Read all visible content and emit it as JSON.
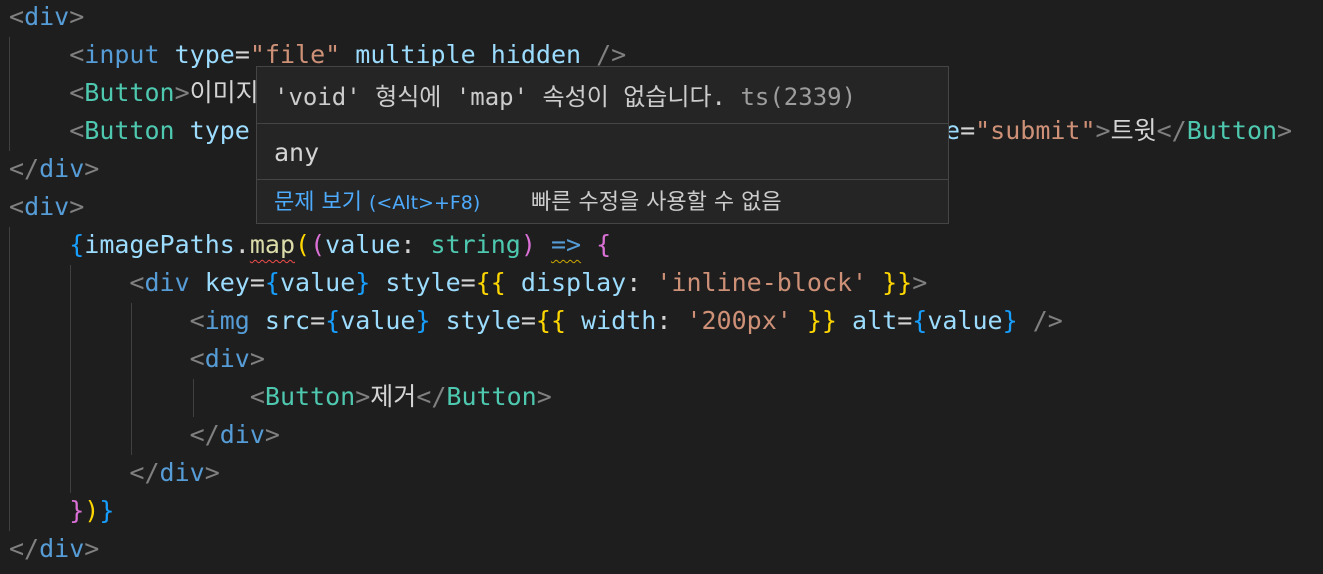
{
  "colors": {
    "background": "#1e1e1e",
    "tag": "#569cd6",
    "component": "#4ec9b0",
    "attribute": "#9cdcfe",
    "string": "#ce9178",
    "error_squiggle": "#f14c4c",
    "link": "#4daafc"
  },
  "code": {
    "l1_open": "<",
    "l1_tag": "div",
    "l1_close": ">",
    "l2_indent": "    ",
    "l2_lt": "<",
    "l2_tag": "input",
    "l2_sp1": " ",
    "l2_attr": "type",
    "l2_eq": "=",
    "l2_val": "\"file\"",
    "l2_sp2": " ",
    "l2_attr2": "multiple",
    "l2_sp3": " ",
    "l2_attr3": "hidden",
    "l2_sp4": " ",
    "l2_end": "/>",
    "l3_indent": "    ",
    "l3_lt": "<",
    "l3_tag": "Button",
    "l3_gt": ">",
    "l3_text": "이미지",
    "l4_indent": "    ",
    "l4_lt": "<",
    "l4_tag": "Button",
    "l4_sp": " ",
    "l4_attr": "type",
    "l4_tail_attr": "e",
    "l4_tail_eq": "=",
    "l4_tail_val": "\"submit\"",
    "l4_tail_gt": ">",
    "l4_tail_text": "트윗",
    "l4_tail_close1": "</",
    "l4_tail_tag": "Button",
    "l4_tail_close2": ">",
    "l5_open": "</",
    "l5_tag": "div",
    "l5_close": ">",
    "l6_open": "<",
    "l6_tag": "div",
    "l6_close": ">",
    "l7_indent": "    ",
    "l7_brace": "{",
    "l7_var": "imagePaths",
    "l7_dot": ".",
    "l7_fn": "map",
    "l7_paren1": "(",
    "l7_paren2": "(",
    "l7_param": "value",
    "l7_colon": ": ",
    "l7_type": "string",
    "l7_paren3": ")",
    "l7_sp": " ",
    "l7_arrow": "=>",
    "l7_sp2": " ",
    "l7_brace2": "{",
    "l8_indent": "        ",
    "l8_lt": "<",
    "l8_tag": "div",
    "l8_sp": " ",
    "l8_attr": "key",
    "l8_eq": "=",
    "l8_b1": "{",
    "l8_val": "value",
    "l8_b2": "}",
    "l8_sp2": " ",
    "l8_attr2": "style",
    "l8_eq2": "=",
    "l8_b3": "{{",
    "l8_sp3": " ",
    "l8_prop": "display",
    "l8_colon": ": ",
    "l8_str": "'inline-block'",
    "l8_sp4": " ",
    "l8_b4": "}}",
    "l8_gt": ">",
    "l9_indent": "            ",
    "l9_lt": "<",
    "l9_tag": "img",
    "l9_sp": " ",
    "l9_attr": "src",
    "l9_eq": "=",
    "l9_b1": "{",
    "l9_val": "value",
    "l9_b2": "}",
    "l9_sp2": " ",
    "l9_attr2": "style",
    "l9_eq2": "=",
    "l9_b3": "{{",
    "l9_sp3": " ",
    "l9_prop": "width",
    "l9_colon": ": ",
    "l9_str": "'200px'",
    "l9_sp4": " ",
    "l9_b4": "}}",
    "l9_sp5": " ",
    "l9_attr3": "alt",
    "l9_eq3": "=",
    "l9_b5": "{",
    "l9_val2": "value",
    "l9_b6": "}",
    "l9_sp6": " ",
    "l9_end": "/>",
    "l10_indent": "            ",
    "l10_lt": "<",
    "l10_tag": "div",
    "l10_gt": ">",
    "l11_indent": "                ",
    "l11_lt": "<",
    "l11_tag": "Button",
    "l11_gt": ">",
    "l11_text": "제거",
    "l11_close1": "</",
    "l11_tag2": "Button",
    "l11_close2": ">",
    "l12_indent": "            ",
    "l12_open": "</",
    "l12_tag": "div",
    "l12_close": ">",
    "l13_indent": "        ",
    "l13_open": "</",
    "l13_tag": "div",
    "l13_close": ">",
    "l14_indent": "    ",
    "l14_b1": "}",
    "l14_b2": ")",
    "l14_b3": "}",
    "l15_open": "</",
    "l15_tag": "div",
    "l15_close": ">"
  },
  "hover": {
    "message": "'void' 형식에 'map' 속성이 없습니다.",
    "code": "ts(2339)",
    "type_text": "any",
    "view_problem_label": "문제 보기",
    "view_problem_shortcut": "(<Alt>+F8)",
    "no_quick_fix": "빠른 수정을 사용할 수 없음"
  }
}
